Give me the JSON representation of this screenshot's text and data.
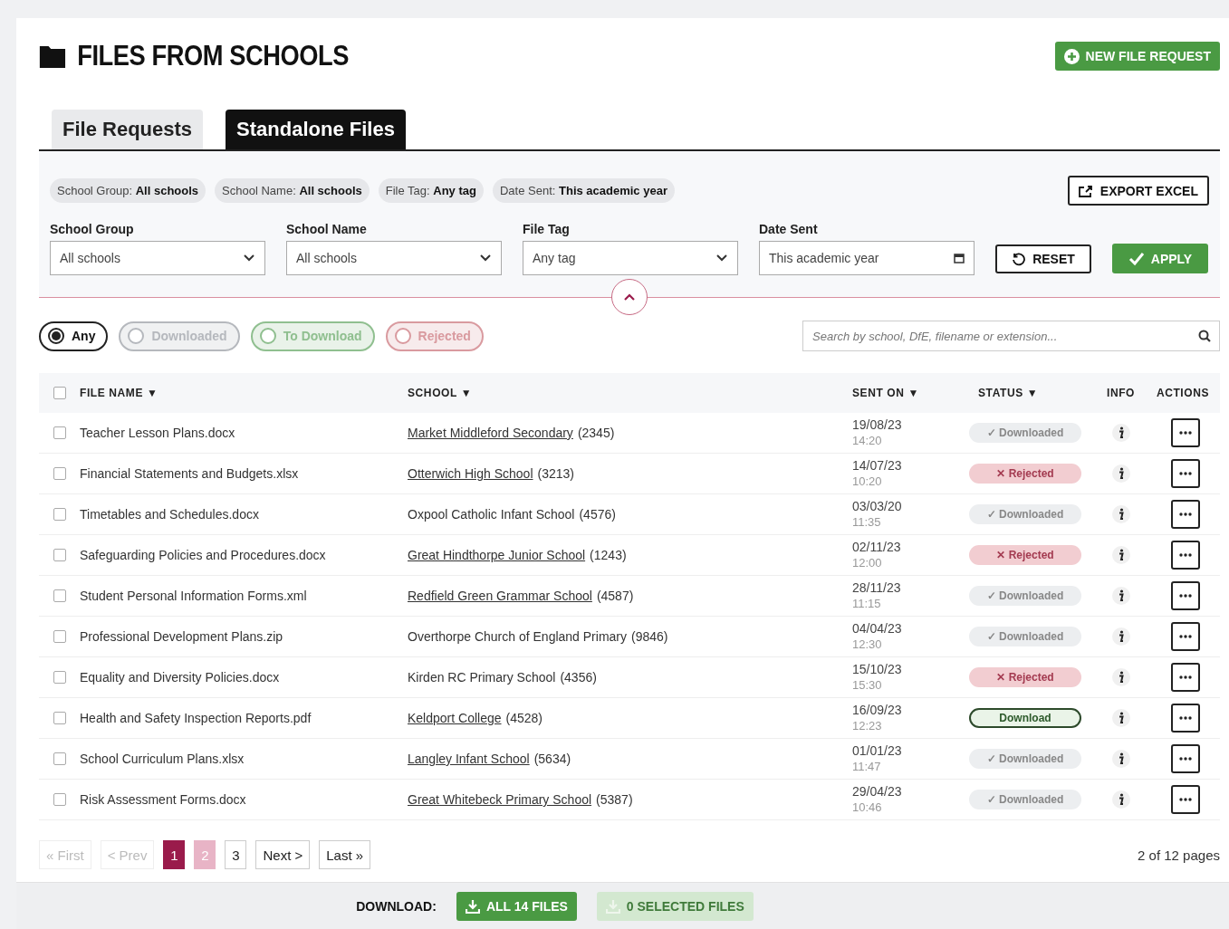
{
  "header": {
    "title": "FILES FROM SCHOOLS",
    "new_request_button": "NEW FILE REQUEST"
  },
  "tabs": [
    {
      "label": "File Requests",
      "selected": false
    },
    {
      "label": "Standalone Files",
      "selected": true
    }
  ],
  "filter_chips": [
    {
      "label": "School Group:",
      "value": "All schools"
    },
    {
      "label": "School Name:",
      "value": "All schools"
    },
    {
      "label": "File Tag:",
      "value": "Any tag"
    },
    {
      "label": "Date Sent:",
      "value": "This academic year"
    }
  ],
  "export_button": "EXPORT EXCEL",
  "filters": [
    {
      "kind": "select",
      "label": "School Group",
      "value": "All schools"
    },
    {
      "kind": "select",
      "label": "School Name",
      "value": "All schools"
    },
    {
      "kind": "select",
      "label": "File Tag",
      "value": "Any tag"
    },
    {
      "kind": "date",
      "label": "Date Sent",
      "value": "This academic year"
    }
  ],
  "reset_button": "RESET",
  "apply_button": "APPLY",
  "status_filters": [
    {
      "label": "Any",
      "selected": true,
      "color": "#222222"
    },
    {
      "label": "Downloaded",
      "selected": false,
      "color": "#b5b8bd"
    },
    {
      "label": "To Download",
      "selected": false,
      "color": "#8fbf8f"
    },
    {
      "label": "Rejected",
      "selected": false,
      "color": "#d99a9f"
    }
  ],
  "search": {
    "placeholder": "Search by school, DfE, filename or extension..."
  },
  "table": {
    "select_all_checked": false,
    "columns": [
      {
        "label": "FILE NAME",
        "sort_mark": "▼"
      },
      {
        "label": "SCHOOL",
        "sort_mark": "▼"
      },
      {
        "label": "SENT ON",
        "sort_mark": "▼"
      },
      {
        "label": "STATUS",
        "sort_mark": "▼"
      },
      {
        "label": "INFO"
      },
      {
        "label": "ACTIONS"
      }
    ],
    "rows": [
      {
        "checked": false,
        "file": "Teacher Lesson Plans.docx",
        "school": "Market Middleford Secondary",
        "linked": true,
        "code": "(2345)",
        "date": "19/08/23",
        "time": "14:20",
        "status": {
          "kind": "downloaded",
          "label": "✓ Downloaded"
        }
      },
      {
        "checked": false,
        "file": "Financial Statements and Budgets.xlsx",
        "school": "Otterwich High School",
        "linked": true,
        "code": "(3213)",
        "date": "14/07/23",
        "time": "10:20",
        "status": {
          "kind": "rejected",
          "label": "✕ Rejected"
        }
      },
      {
        "checked": false,
        "file": "Timetables and Schedules.docx",
        "school": "Oxpool Catholic Infant School",
        "linked": false,
        "code": "(4576)",
        "date": "03/03/20",
        "time": "11:35",
        "status": {
          "kind": "downloaded",
          "label": "✓ Downloaded"
        }
      },
      {
        "checked": false,
        "file": "Safeguarding Policies and Procedures.docx",
        "school": "Great Hindthorpe Junior School",
        "linked": true,
        "code": "(1243)",
        "date": "02/11/23",
        "time": "12:00",
        "status": {
          "kind": "rejected",
          "label": "✕ Rejected"
        }
      },
      {
        "checked": false,
        "file": "Student Personal Information Forms.xml",
        "school": "Redfield Green Grammar School",
        "linked": true,
        "code": "(4587)",
        "date": "28/11/23",
        "time": "11:15",
        "status": {
          "kind": "downloaded",
          "label": "✓ Downloaded"
        }
      },
      {
        "checked": false,
        "file": "Professional Development Plans.zip",
        "school": "Overthorpe Church of England Primary",
        "linked": false,
        "code": "(9846)",
        "date": "04/04/23",
        "time": "12:30",
        "status": {
          "kind": "downloaded",
          "label": "✓ Downloaded"
        }
      },
      {
        "checked": false,
        "file": "Equality and Diversity Policies.docx",
        "school": "Kirden RC Primary School",
        "linked": false,
        "code": "(4356)",
        "date": "15/10/23",
        "time": "15:30",
        "status": {
          "kind": "rejected",
          "label": "✕ Rejected"
        }
      },
      {
        "checked": false,
        "file": "Health and Safety Inspection Reports.pdf",
        "school": "Keldport College",
        "linked": true,
        "code": "(4528)",
        "date": "16/09/23",
        "time": "12:23",
        "status": {
          "kind": "download",
          "label": "Download"
        }
      },
      {
        "checked": false,
        "file": "School Curriculum Plans.xlsx",
        "school": "Langley Infant School",
        "linked": true,
        "code": "(5634)",
        "date": "01/01/23",
        "time": "11:47",
        "status": {
          "kind": "downloaded",
          "label": "✓ Downloaded"
        }
      },
      {
        "checked": false,
        "file": "Risk Assessment Forms.docx",
        "school": "Great Whitebeck Primary School",
        "linked": true,
        "code": "(5387)",
        "date": "29/04/23",
        "time": "10:46",
        "status": {
          "kind": "downloaded",
          "label": "✓ Downloaded"
        }
      }
    ]
  },
  "pagination": {
    "pages": [
      {
        "label": "« First",
        "kind": "nav",
        "disabled": true
      },
      {
        "label": "< Prev",
        "kind": "nav",
        "disabled": true
      },
      {
        "label": "1",
        "kind": "page",
        "disabled": false,
        "selected": true
      },
      {
        "label": "2",
        "kind": "page",
        "disabled": false,
        "selected": false,
        "highlighted": true
      },
      {
        "label": "3",
        "kind": "page",
        "disabled": false,
        "selected": false
      },
      {
        "label": "Next >",
        "kind": "nav",
        "disabled": false
      },
      {
        "label": "Last »",
        "kind": "nav",
        "disabled": false
      }
    ],
    "summary": "2 of 12 pages"
  },
  "footer": {
    "label": "DOWNLOAD:",
    "buttons": [
      {
        "label": "ALL 14 FILES",
        "disabled": false
      },
      {
        "label": "0 SELECTED FILES",
        "disabled": true
      }
    ]
  }
}
